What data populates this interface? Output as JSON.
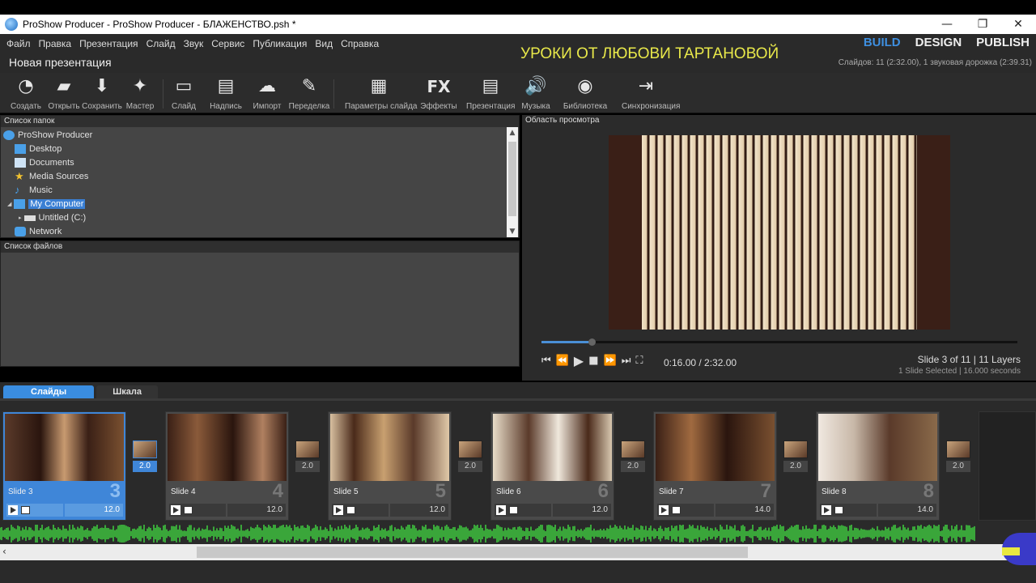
{
  "window": {
    "title": "ProShow Producer - ProShow Producer - БЛАЖЕНСТВО.psh *",
    "minimize": "—",
    "maximize": "❐",
    "close": "✕"
  },
  "menu": [
    "Файл",
    "Правка",
    "Презентация",
    "Слайд",
    "Звук",
    "Сервис",
    "Публикация",
    "Вид",
    "Справка"
  ],
  "watermark": "УРОКИ ОТ ЛЮБОВИ ТАРТАНОВОЙ",
  "modes": {
    "build": "BUILD",
    "design": "DESIGN",
    "publish": "PUBLISH"
  },
  "presentation": {
    "title": "Новая презентация",
    "info": "Слайдов: 11 (2:32.00), 1 звуковая дорожка (2:39.31)"
  },
  "toolbar": [
    {
      "label": "Создать",
      "icon": "create-icon"
    },
    {
      "label": "Открыть",
      "icon": "open-folder-icon"
    },
    {
      "label": "Сохранить",
      "icon": "save-icon"
    },
    {
      "label": "Мастер",
      "icon": "wizard-icon"
    },
    {
      "label": "Слайд",
      "icon": "add-slide-icon"
    },
    {
      "label": "Надпись",
      "icon": "caption-icon"
    },
    {
      "label": "Импорт",
      "icon": "import-icon"
    },
    {
      "label": "Переделка",
      "icon": "remix-icon"
    },
    {
      "label": "Параметры слайда",
      "icon": "slide-options-icon"
    },
    {
      "label": "Эффекты",
      "icon": "fx-icon"
    },
    {
      "label": "Презентация",
      "icon": "show-options-icon"
    },
    {
      "label": "Музыка",
      "icon": "music-icon"
    },
    {
      "label": "Библиотека",
      "icon": "library-icon"
    },
    {
      "label": "Синхронизация",
      "icon": "sync-icon"
    }
  ],
  "folders": {
    "header": "Список папок",
    "items": [
      {
        "label": "ProShow Producer",
        "icon": "proshow-icon"
      },
      {
        "label": "Desktop",
        "icon": "desktop-icon"
      },
      {
        "label": "Documents",
        "icon": "documents-icon"
      },
      {
        "label": "Media Sources",
        "icon": "star-icon"
      },
      {
        "label": "Music",
        "icon": "music-note-icon"
      },
      {
        "label": "My Computer",
        "icon": "computer-icon"
      },
      {
        "label": "Untitled (C:)",
        "icon": "drive-icon"
      },
      {
        "label": "Network",
        "icon": "network-icon"
      }
    ]
  },
  "files": {
    "header": "Список файлов"
  },
  "preview": {
    "header": "Область просмотра",
    "progress": 0.105,
    "time": "0:16.00 / 2:32.00",
    "slide_info": "Slide 3 of 11  |  11 Layers",
    "selected_info": "1 Slide Selected  |  16.000 seconds"
  },
  "tabs": {
    "slides": "Слайды",
    "timeline": "Шкала"
  },
  "slides": [
    {
      "name": "Slide 3",
      "number": "3",
      "duration": "12.0",
      "transition": "2.0"
    },
    {
      "name": "Slide 4",
      "number": "4",
      "duration": "12.0",
      "transition": "2.0"
    },
    {
      "name": "Slide 5",
      "number": "5",
      "duration": "12.0",
      "transition": "2.0"
    },
    {
      "name": "Slide 6",
      "number": "6",
      "duration": "12.0",
      "transition": "2.0"
    },
    {
      "name": "Slide 7",
      "number": "7",
      "duration": "14.0",
      "transition": "2.0"
    },
    {
      "name": "Slide 8",
      "number": "8",
      "duration": "14.0",
      "transition": "2.0"
    }
  ],
  "colors": {
    "accent": "#3a8de0",
    "waveform": "#3fcf3f",
    "watermark": "#e8e84a"
  }
}
